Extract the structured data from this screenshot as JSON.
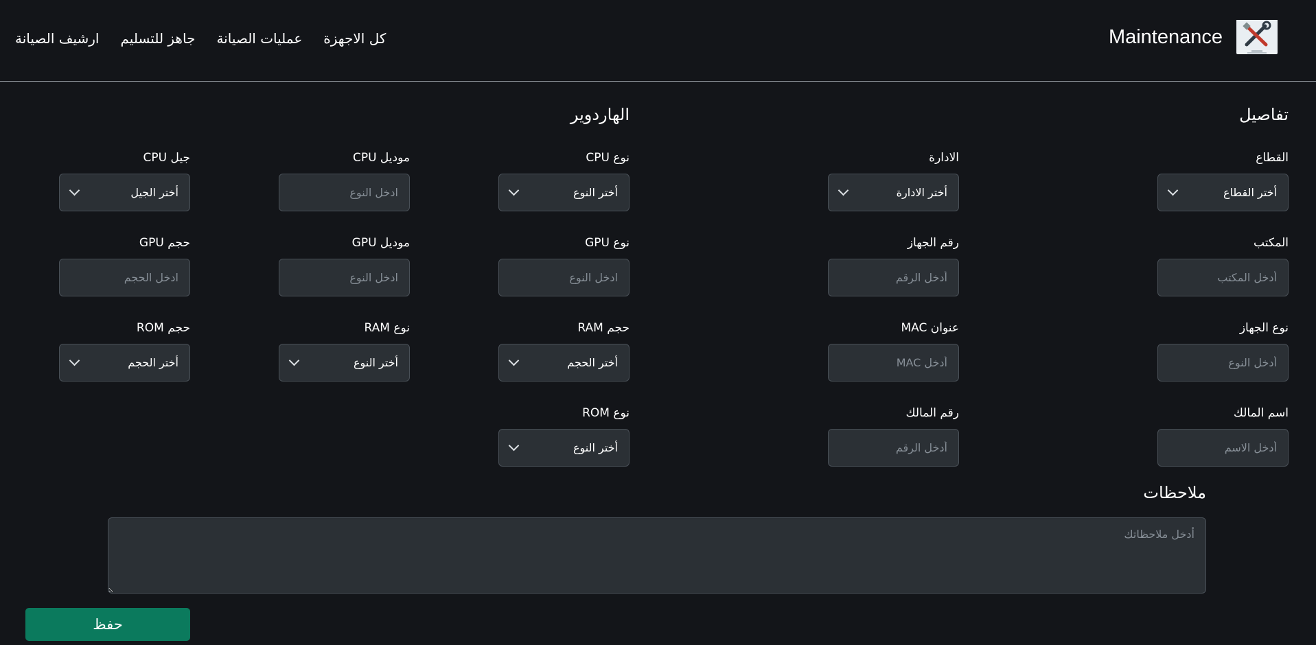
{
  "navbar": {
    "brand_title": "Maintenance",
    "links": [
      "كل الاجهزة",
      "عمليات الصيانة",
      "جاهز للتسليم",
      "ارشيف الصيانة"
    ]
  },
  "details": {
    "title": "تفاصيل",
    "sector": {
      "label": "القطاع",
      "value": "أختر القطاع"
    },
    "department": {
      "label": "الادارة",
      "value": "أختر الادارة"
    },
    "office": {
      "label": "المكتب",
      "placeholder": "أدخل المكتب"
    },
    "device_number": {
      "label": "رقم الجهاز",
      "placeholder": "أدخل الرقم"
    },
    "device_type": {
      "label": "نوع الجهاز",
      "placeholder": "أدخل النوع"
    },
    "mac_address": {
      "label": "عنوان MAC",
      "placeholder": "أدخل MAC"
    },
    "owner_name": {
      "label": "اسم المالك",
      "placeholder": "أدخل الاسم"
    },
    "owner_number": {
      "label": "رقم المالك",
      "placeholder": "أدخل الرقم"
    }
  },
  "hardware": {
    "title": "الهاردوير",
    "cpu_type": {
      "label": "نوع CPU",
      "value": "أختر النوع"
    },
    "cpu_model": {
      "label": "موديل CPU",
      "placeholder": "ادخل النوع"
    },
    "cpu_gen": {
      "label": "جيل CPU",
      "value": "أختر الجيل"
    },
    "gpu_type": {
      "label": "نوع GPU",
      "placeholder": "ادخل النوع"
    },
    "gpu_model": {
      "label": "موديل GPU",
      "placeholder": "ادخل النوع"
    },
    "gpu_size": {
      "label": "حجم GPU",
      "placeholder": "ادخل الحجم"
    },
    "ram_size": {
      "label": "حجم RAM",
      "value": "أختر الحجم"
    },
    "ram_type": {
      "label": "نوع RAM",
      "value": "أختر النوع"
    },
    "rom_size": {
      "label": "حجم ROM",
      "value": "أختر الحجم"
    },
    "rom_type": {
      "label": "نوع ROM",
      "value": "أختر النوع"
    }
  },
  "notes": {
    "title": "ملاحظات",
    "placeholder": "أدخل ملاحظاتك"
  },
  "save_label": "حفظ",
  "icons": {
    "logo": "tools-icon",
    "select": "chevron-down-icon"
  },
  "colors": {
    "background": "#131519",
    "field_bg": "#2b3035",
    "save_button": "#0b7a5d"
  }
}
